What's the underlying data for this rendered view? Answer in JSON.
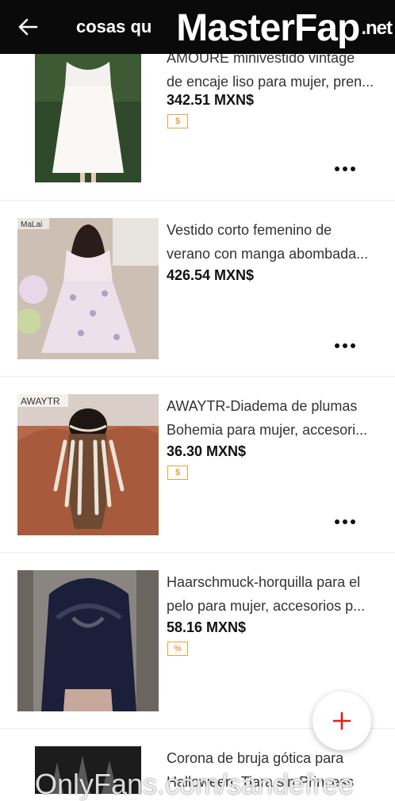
{
  "header": {
    "title": "cosas qu"
  },
  "watermark_top": {
    "main": "MasterFap",
    "suffix": ".net"
  },
  "items": [
    {
      "name_line1": "AMOURE minivestido vintage",
      "name_line2": "de encaje liso para mujer, pren...",
      "price": "342.51 MXN$",
      "badge": "$"
    },
    {
      "name_line1": "Vestido corto femenino de",
      "name_line2": "verano con manga abombada...",
      "price": "426.54 MXN$",
      "badge": "",
      "thumb_label": "MaLai"
    },
    {
      "name_line1": "AWAYTR-Diadema de plumas",
      "name_line2": "Bohemia para mujer, accesori...",
      "price": "36.30 MXN$",
      "badge": "$",
      "thumb_label": "AWAYTR"
    },
    {
      "name_line1": "Haarschmuck-horquilla para el",
      "name_line2": "pelo para mujer, accesorios p...",
      "price": "58.16 MXN$",
      "badge": "%"
    },
    {
      "name_line1": "Corona de bruja gótica para",
      "name_line2": "Halloween, Tiara sin Princess",
      "price": "",
      "badge": ""
    }
  ],
  "watermark_bottom": "OnlyFans.com/sandefree",
  "colors": {
    "accent_red": "#e02020",
    "badge_orange": "#e8a23a"
  }
}
